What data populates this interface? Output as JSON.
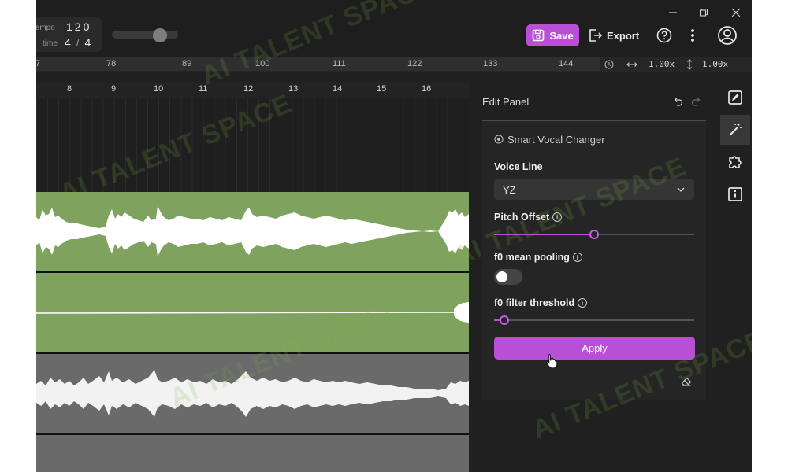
{
  "topbar": {
    "tempo_label": "tempo",
    "tempo_value": "120",
    "time_label": "time",
    "time_sig_num": "4",
    "time_sig_sep": "/",
    "time_sig_den": "4",
    "save_label": "Save",
    "export_label": "Export"
  },
  "ruler": {
    "values": [
      "7",
      "78",
      "89",
      "100",
      "111",
      "122",
      "133",
      "144"
    ],
    "h_zoom": "1.00x",
    "v_zoom": "1.00x"
  },
  "timeline": {
    "bars": [
      "8",
      "9",
      "10",
      "11",
      "12",
      "13",
      "14",
      "15",
      "16"
    ]
  },
  "panel": {
    "title": "Edit Panel",
    "mode": "Smart Vocal Changer",
    "voice_line_label": "Voice Line",
    "voice_line_value": "YZ",
    "pitch_offset_label": "Pitch Offset",
    "pitch_offset_fraction": 0.5,
    "f0_pooling_label": "f0 mean pooling",
    "f0_pooling_enabled": false,
    "f0_threshold_label": "f0 filter threshold",
    "f0_threshold_fraction": 0.05,
    "apply_label": "Apply"
  },
  "watermark": "AI TALENT SPACE",
  "colors": {
    "accent": "#b84fd6",
    "track_green": "#7fa35f",
    "track_gray": "#6a6a6a",
    "background": "#202020"
  }
}
